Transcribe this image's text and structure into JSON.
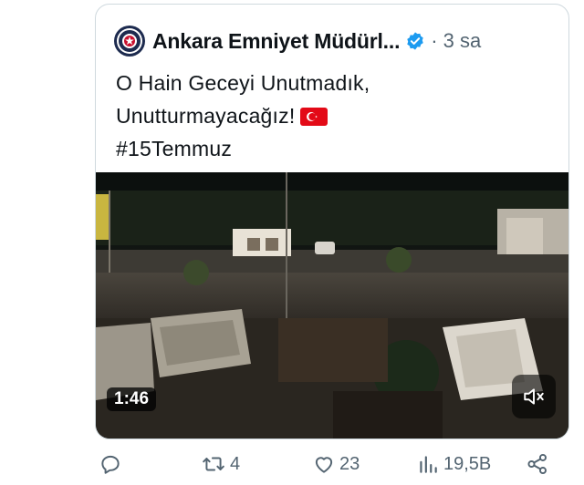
{
  "tweet": {
    "display_name": "Ankara Emniyet Müdürl...",
    "separator": "·",
    "time": "3 sa",
    "text_line1": "O Hain Geceyi Unutmadık,",
    "text_line2": "Unutturmayacağız!",
    "hashtag": "#15Temmuz",
    "flag_emoji": "turkey-flag"
  },
  "media": {
    "duration": "1:46",
    "muted": true
  },
  "actions": {
    "reply_count": "",
    "retweet_count": "4",
    "like_count": "23",
    "views_count": "19,5B"
  },
  "colors": {
    "verified_blue": "#1d9bf0",
    "text_primary": "#0f1419",
    "text_secondary": "#536471",
    "border": "#cfd9de"
  }
}
